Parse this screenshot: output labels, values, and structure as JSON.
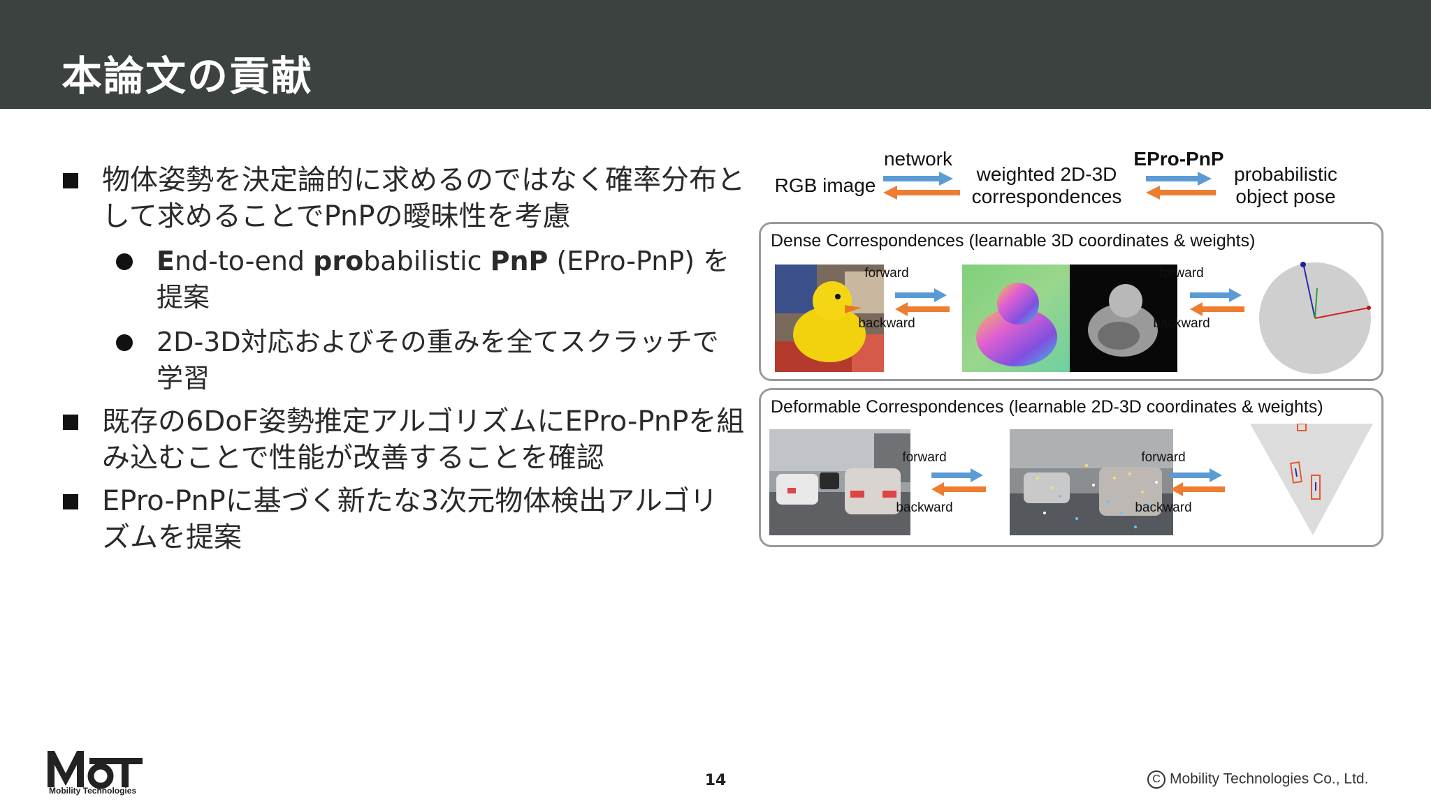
{
  "slide": {
    "title": "本論文の貢献",
    "page_number": "14",
    "copyright": "Mobility Technologies Co., Ltd.",
    "copyright_symbol": "C",
    "logo_mark": "MoT",
    "logo_text": "Mobility Technologies"
  },
  "bullets": {
    "b1": "物体姿勢を決定論的に求めるのではなく確率分布として求めることでPnPの曖昧性を考慮",
    "sub1": {
      "p1": "E",
      "p2": "nd-to-end ",
      "p3": "pro",
      "p4": "babilistic ",
      "p5": "PnP",
      "p6": " (EPro-PnP) を提案"
    },
    "sub2": "2D-3D対応およびその重みを全てスクラッチで学習",
    "b2": "既存の6DoF姿勢推定アルゴリズムにEPro-PnPを組み込むことで性能が改善することを確認",
    "b3": "EPro-PnPに基づく新たな3次元物体検出アルゴリズムを提案"
  },
  "figure": {
    "rgb_image": "RGB image",
    "network": "network",
    "weighted": "weighted 2D-3D",
    "correspondences": "correspondences",
    "epro": "EPro-PnP",
    "probabilistic": "probabilistic",
    "object_pose": "object pose",
    "dense_title": "Dense Correspondences (learnable 3D coordinates & weights)",
    "deform_title": "Deformable Correspondences (learnable 2D-3D coordinates & weights)",
    "forward": "forward",
    "backward": "backward",
    "colors": {
      "forward_arrow": "#5b9bd5",
      "backward_arrow": "#ed7d31"
    }
  }
}
